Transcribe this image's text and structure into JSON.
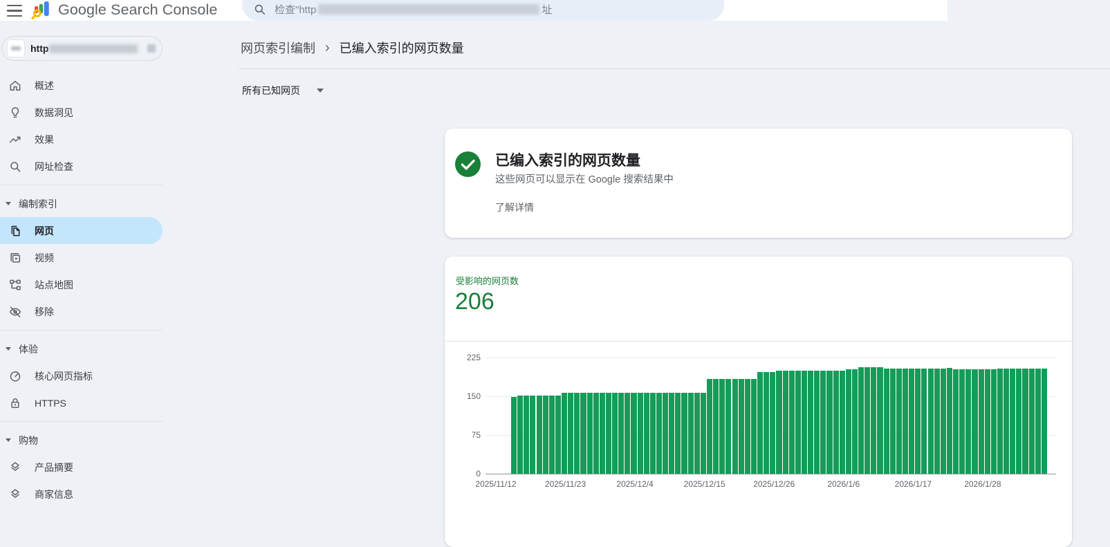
{
  "topbar": {
    "app_title": "Google Search Console",
    "search": {
      "placeholder_prefix": "检查\"http",
      "placeholder_suffix": "址",
      "redacted_middle": true,
      "icon": "search-icon"
    },
    "menu_icon": "hamburger-menu-icon",
    "logo_icon": "search-console-logo-icon"
  },
  "sidebar": {
    "property": {
      "prefix": "http",
      "redacted": true,
      "favicon": "white-square"
    },
    "nav": [
      {
        "type": "item",
        "name": "overview",
        "icon": "home-icon",
        "label": "概述"
      },
      {
        "type": "item",
        "name": "insights",
        "icon": "lightbulb-icon",
        "label": "数据洞见"
      },
      {
        "type": "item",
        "name": "performance",
        "icon": "trending-up-icon",
        "label": "效果"
      },
      {
        "type": "item",
        "name": "url-inspection",
        "icon": "search-icon",
        "label": "网址检查"
      },
      {
        "type": "divider"
      },
      {
        "type": "section",
        "name": "indexing",
        "label": "编制索引"
      },
      {
        "type": "item",
        "name": "pages",
        "icon": "pages-icon",
        "label": "网页",
        "selected": true
      },
      {
        "type": "item",
        "name": "videos",
        "icon": "video-icon",
        "label": "视频"
      },
      {
        "type": "item",
        "name": "sitemaps",
        "icon": "sitemap-icon",
        "label": "站点地图"
      },
      {
        "type": "item",
        "name": "removals",
        "icon": "eye-off-icon",
        "label": "移除"
      },
      {
        "type": "divider"
      },
      {
        "type": "section",
        "name": "experience",
        "label": "体验"
      },
      {
        "type": "item",
        "name": "core-web-vitals",
        "icon": "gauge-icon",
        "label": "核心网页指标"
      },
      {
        "type": "item",
        "name": "https",
        "icon": "lock-icon",
        "label": "HTTPS"
      },
      {
        "type": "divider"
      },
      {
        "type": "section",
        "name": "shopping",
        "label": "购物"
      },
      {
        "type": "item",
        "name": "product-snippets",
        "icon": "layers-diamond-icon",
        "label": "产品摘要"
      },
      {
        "type": "item",
        "name": "merchant-listings",
        "icon": "layers-diamond-icon",
        "label": "商家信息"
      }
    ]
  },
  "breadcrumb": {
    "parent": "网页索引编制",
    "separator": "›",
    "current": "已编入索引的网页数量"
  },
  "filter": {
    "label": "所有已知网页"
  },
  "status_card": {
    "icon": "success-check-icon",
    "title": "已编入索引的网页数量",
    "subtitle": "这些网页可以显示在 Google 搜索结果中",
    "link": "了解详情"
  },
  "metric": {
    "label": "受影响的网页数",
    "value": "206"
  },
  "chart_data": {
    "type": "bar",
    "title": "受影响的网页数",
    "current_value": 206,
    "granularity": "daily",
    "start_date": "2025/11/15",
    "end_date": "2026/2/7",
    "x_tick_labels": [
      "2025/11/12",
      "2025/11/23",
      "2025/12/4",
      "2025/12/15",
      "2025/12/26",
      "2026/1/6",
      "2026/1/17",
      "2026/1/28"
    ],
    "y_ticks": [
      0,
      75,
      150,
      225
    ],
    "ylim": [
      0,
      225
    ],
    "grid": "horizontal",
    "legend": "none",
    "bar_color": "#149c58",
    "values": [
      149,
      152,
      152,
      152,
      152,
      152,
      152,
      152,
      157,
      157,
      157,
      157,
      157,
      157,
      157,
      157,
      157,
      157,
      157,
      157,
      157,
      157,
      157,
      157,
      157,
      157,
      157,
      157,
      157,
      157,
      157,
      184,
      184,
      184,
      184,
      184,
      184,
      184,
      184,
      197,
      197,
      197,
      199,
      199,
      199,
      199,
      199,
      199,
      200,
      200,
      200,
      200,
      200,
      202,
      202,
      206,
      206,
      206,
      206,
      204,
      204,
      203,
      203,
      203,
      203,
      203,
      203,
      203,
      203,
      205,
      202,
      202,
      202,
      202,
      202,
      202,
      202,
      203,
      203,
      203,
      203,
      203,
      203,
      203,
      203
    ]
  },
  "colors": {
    "page_bg": "#eef1f6",
    "card_bg": "#ffffff",
    "search_pill_bg": "#e8eef8",
    "selected_item_bg": "#c3e6fc",
    "green_dark": "#188038",
    "bar_green": "#149c58",
    "text_primary": "#202124",
    "text_secondary": "#5f6368"
  }
}
